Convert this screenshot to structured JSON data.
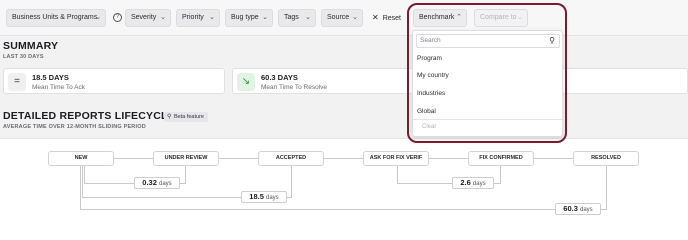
{
  "filters": {
    "business_units": "Business Units & Programs",
    "severity": "Severity",
    "priority": "Priority",
    "bug_type": "Bug type",
    "tags": "Tags",
    "source": "Source",
    "reset": "Reset",
    "benchmark": "Benchmark",
    "compare_to": "Compare to"
  },
  "summary": {
    "title": "SUMMARY",
    "subtitle": "LAST 30 DAYS",
    "kpis": [
      {
        "value": "18.5 DAYS",
        "label": "Mean Time To Ack"
      },
      {
        "value": "60.3 DAYS",
        "label": "Mean Time To Resolve"
      }
    ]
  },
  "lifecycle": {
    "title": "DETAILED REPORTS LIFECYCLE",
    "beta": "Beta feature",
    "subtitle": "AVERAGE TIME OVER 12-MONTH SLIDING PERIOD",
    "stages": [
      "NEW",
      "UNDER REVIEW",
      "ACCEPTED",
      "ASK FOR FIX VERIF",
      "FIX CONFIRMED",
      "RESOLVED"
    ],
    "durations": [
      {
        "value": "0.32",
        "unit": "days"
      },
      {
        "value": "18.5",
        "unit": "days"
      },
      {
        "value": "2.6",
        "unit": "days"
      },
      {
        "value": "60.3",
        "unit": "days"
      }
    ]
  },
  "benchmark_dropdown": {
    "search_placeholder": "Search",
    "options": [
      "Program",
      "My country",
      "Industries",
      "Global"
    ],
    "clear": "Clear"
  },
  "colors": {
    "highlight": "#7b1c2a",
    "resolve_icon": "#2b8a3e"
  }
}
